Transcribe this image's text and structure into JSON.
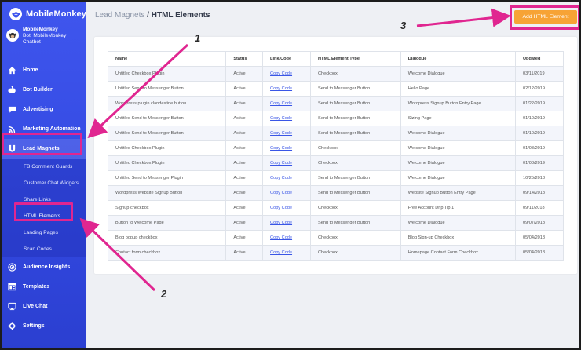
{
  "brand": {
    "name_part1": "Mobile",
    "name_part2": "Monkey"
  },
  "account": {
    "name": "MobileMonkey",
    "bot_line1": "Bot: MobileMonkey",
    "bot_line2": "Chatbot"
  },
  "nav": {
    "home": "Home",
    "bot_builder": "Bot Builder",
    "advertising": "Advertising",
    "marketing_automation": "Marketing Automation",
    "lead_magnets": "Lead Magnets",
    "sub": {
      "fb_comment_guards": "FB Comment Guards",
      "customer_chat_widgets": "Customer Chat Widgets",
      "share_links": "Share Links",
      "html_elements": "HTML Elements",
      "landing_pages": "Landing Pages",
      "scan_codes": "Scan Codes"
    },
    "audience_insights": "Audience Insights",
    "templates": "Templates",
    "live_chat": "Live Chat",
    "settings": "Settings"
  },
  "header": {
    "crumb_parent": "Lead Magnets",
    "crumb_sep": " / ",
    "crumb_current": "HTML Elements",
    "add_button": "Add HTML Element"
  },
  "table": {
    "headers": {
      "name": "Name",
      "status": "Status",
      "link": "Link/Code",
      "type": "HTML Element Type",
      "dialogue": "Dialogue",
      "updated": "Updated"
    },
    "rows": [
      {
        "name": "Untitled Checkbox Plugin",
        "status": "Active",
        "link": "Copy Code",
        "type": "Checkbox",
        "dialogue": "Welcome Dialogue",
        "updated": "03/11/2019"
      },
      {
        "name": "Untitled Send to Messenger Button",
        "status": "Active",
        "link": "Copy Code",
        "type": "Send to Messenger Button",
        "dialogue": "Hello Page",
        "updated": "02/12/2019"
      },
      {
        "name": "Wordpress plugin clandestine button",
        "status": "Active",
        "link": "Copy Code",
        "type": "Send to Messenger Button",
        "dialogue": "Wordpress Signup Button Entry Page",
        "updated": "01/22/2019"
      },
      {
        "name": "Untitled Send to Messenger Button",
        "status": "Active",
        "link": "Copy Code",
        "type": "Send to Messenger Button",
        "dialogue": "Sizing Page",
        "updated": "01/10/2019"
      },
      {
        "name": "Untitled Send to Messenger Button",
        "status": "Active",
        "link": "Copy Code",
        "type": "Send to Messenger Button",
        "dialogue": "Welcome Dialogue",
        "updated": "01/10/2019"
      },
      {
        "name": "Untitled Checkbox Plugin",
        "status": "Active",
        "link": "Copy Code",
        "type": "Checkbox",
        "dialogue": "Welcome Dialogue",
        "updated": "01/08/2019"
      },
      {
        "name": "Untitled Checkbox Plugin",
        "status": "Active",
        "link": "Copy Code",
        "type": "Checkbox",
        "dialogue": "Welcome Dialogue",
        "updated": "01/08/2019"
      },
      {
        "name": "Untitled Send to Messenger Plugin",
        "status": "Active",
        "link": "Copy Code",
        "type": "Send to Messenger Button",
        "dialogue": "Welcome Dialogue",
        "updated": "10/25/2018"
      },
      {
        "name": "Wordpress Website Signup Button",
        "status": "Active",
        "link": "Copy Code",
        "type": "Send to Messenger Button",
        "dialogue": "Website Signup Button Entry Page",
        "updated": "09/14/2018"
      },
      {
        "name": "Signup checkbox",
        "status": "Active",
        "link": "Copy Code",
        "type": "Checkbox",
        "dialogue": "Free Account Drip Tip 1",
        "updated": "09/11/2018"
      },
      {
        "name": "Button to Welcome Page",
        "status": "Active",
        "link": "Copy Code",
        "type": "Send to Messenger Button",
        "dialogue": "Welcome Dialogue",
        "updated": "09/07/2018"
      },
      {
        "name": "Blog popup checkbox",
        "status": "Active",
        "link": "Copy Code",
        "type": "Checkbox",
        "dialogue": "Blog Sign-up Checkbox",
        "updated": "05/04/2018"
      },
      {
        "name": "Contact form checkbox",
        "status": "Active",
        "link": "Copy Code",
        "type": "Checkbox",
        "dialogue": "Homepage Contact Form Checkbox",
        "updated": "05/04/2018"
      }
    ]
  },
  "annotations": {
    "n1": "1",
    "n2": "2",
    "n3": "3"
  },
  "colors": {
    "sidebar": "#3f56ee",
    "accent_button": "#f7a335",
    "annotation": "#e02690",
    "link": "#3a56e6"
  }
}
